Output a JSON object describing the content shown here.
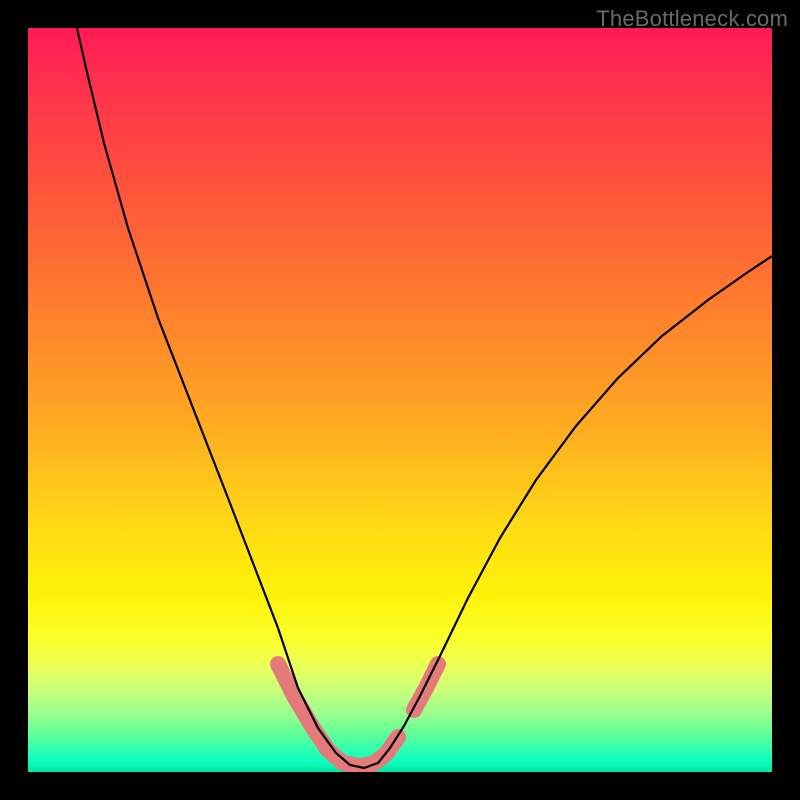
{
  "watermark_text": "TheBottleneck.com",
  "colors": {
    "frame_background": "#000000",
    "watermark": "#6a6a6a",
    "curve_stroke": "#000000",
    "marker_stroke": "#e47a7a",
    "gradient_stops": [
      "#ff1a56",
      "#ff2d4f",
      "#ff4a3f",
      "#ff6a33",
      "#ff8a2a",
      "#ffb020",
      "#ffd716",
      "#fff20a",
      "#fbff2a",
      "#eaff5a",
      "#c8ff7a",
      "#9dff8c",
      "#5eff9a",
      "#2effb0",
      "#10ffc0",
      "#00e8a0"
    ]
  },
  "chart_data": {
    "type": "line",
    "title": "",
    "xlabel": "",
    "ylabel": "",
    "xlim": [
      0,
      100
    ],
    "ylim": [
      0,
      100
    ],
    "grid": false,
    "legend": false,
    "series": [
      {
        "name": "bottleneck-curve",
        "x": [
          6,
          10,
          15,
          20,
          25,
          30,
          33,
          36,
          38,
          40,
          42,
          44,
          46,
          48,
          50,
          55,
          60,
          65,
          70,
          75,
          80,
          85,
          90,
          95,
          100
        ],
        "y": [
          100,
          85,
          68,
          52,
          36,
          22,
          14,
          8,
          4,
          2,
          1,
          0.5,
          0.5,
          1,
          3,
          10,
          18,
          27,
          35,
          43,
          50,
          56,
          62,
          67,
          71
        ]
      }
    ],
    "annotations": [
      {
        "name": "optimal-region-marker",
        "kind": "highlight",
        "color": "#e47a7a",
        "x_range": [
          33,
          50
        ],
        "note": "salmon thick stroke in valley near y=0, plus small arc near x≈51–55"
      }
    ],
    "background": {
      "kind": "vertical-gradient",
      "from": "red-pink",
      "to": "green",
      "mapping": "top=high bottleneck (bad), bottom=low bottleneck (good)"
    }
  }
}
